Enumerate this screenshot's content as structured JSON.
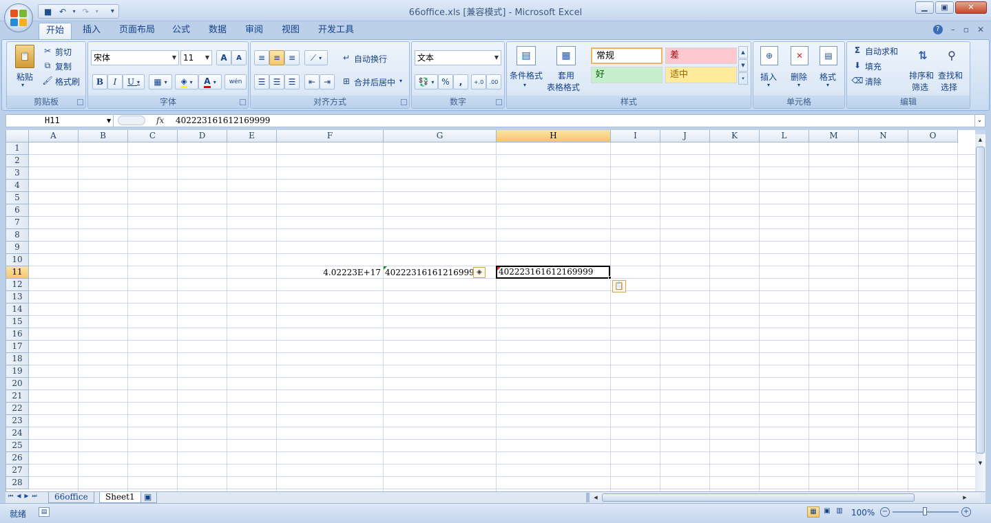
{
  "window": {
    "title": "66office.xls  [兼容模式] - Microsoft Excel"
  },
  "qat": {
    "save_icon": "save-icon",
    "undo_icon": "undo-icon",
    "redo_icon": "redo-icon",
    "customize": "▾"
  },
  "tabs": [
    "开始",
    "插入",
    "页面布局",
    "公式",
    "数据",
    "审阅",
    "视图",
    "开发工具"
  ],
  "ribbon": {
    "clipboard": {
      "label": "剪贴板",
      "paste": "粘贴",
      "cut": "剪切",
      "copy": "复制",
      "format_painter": "格式刷"
    },
    "font": {
      "label": "字体",
      "font_name": "宋体",
      "font_size": "11",
      "grow": "A",
      "shrink": "A",
      "bold": "B",
      "italic": "I",
      "underline": "U",
      "font_color": "A",
      "phonetic": "wén"
    },
    "alignment": {
      "label": "对齐方式",
      "wrap_text": "自动换行",
      "merge_center": "合并后居中"
    },
    "number": {
      "label": "数字",
      "format": "文本",
      "percent": "%",
      "comma": ",",
      "inc_decimal": "+.0",
      "dec_decimal": ".00"
    },
    "styles": {
      "label": "样式",
      "conditional": "条件格式",
      "table_format_1": "套用",
      "table_format_2": "表格格式",
      "normal": "常规",
      "bad": "差",
      "good": "好",
      "neutral": "适中"
    },
    "cells": {
      "label": "单元格",
      "insert": "插入",
      "delete": "删除",
      "format": "格式"
    },
    "editing": {
      "label": "编辑",
      "autosum": "自动求和",
      "fill": "填充",
      "clear": "清除",
      "sort_1": "排序和",
      "sort_2": "筛选",
      "find_1": "查找和",
      "find_2": "选择"
    }
  },
  "formula_bar": {
    "name_box": "H11",
    "fx": "fx",
    "content": "402223161612169999"
  },
  "columns": [
    "A",
    "B",
    "C",
    "D",
    "E",
    "F",
    "G",
    "H",
    "I",
    "J",
    "K",
    "L",
    "M",
    "N",
    "O"
  ],
  "selected_column": "H",
  "rows": [
    "1",
    "2",
    "3",
    "4",
    "5",
    "6",
    "7",
    "8",
    "9",
    "10",
    "11",
    "12",
    "13",
    "14",
    "15",
    "16",
    "17",
    "18",
    "19",
    "20",
    "21",
    "22",
    "23",
    "24",
    "25",
    "26",
    "27",
    "28"
  ],
  "selected_row": "11",
  "cells": {
    "F11": "4.02223E+17",
    "G11": "402223161612169999",
    "H11": "402223161612169999"
  },
  "sheets": {
    "tabs": [
      "66office",
      "Sheet1"
    ],
    "active": "Sheet1"
  },
  "status": {
    "mode": "就绪",
    "zoom": "100%"
  },
  "colors": {
    "accent": "#15428b",
    "selected_header": "#f6c66c",
    "good_bg": "#c6efce",
    "bad_bg": "#ffc7ce",
    "neutral_bg": "#ffeb9c"
  }
}
